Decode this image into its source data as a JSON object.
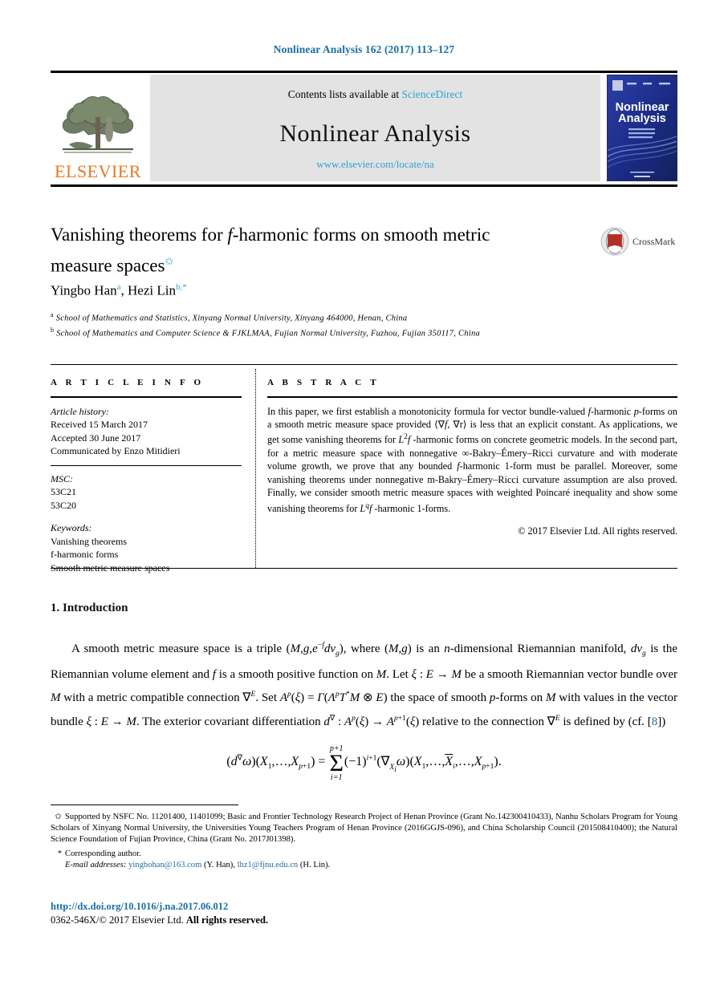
{
  "running_head": "Nonlinear Analysis 162 (2017) 113–127",
  "masthead": {
    "publisher_name": "ELSEVIER",
    "contents_prefix": "Contents lists available at ",
    "contents_link": "ScienceDirect",
    "journal_name": "Nonlinear Analysis",
    "journal_url": "www.elsevier.com/locate/na",
    "cover_title_line1": "Nonlinear",
    "cover_title_line2": "Analysis"
  },
  "article": {
    "title_part1": "Vanishing theorems for ",
    "title_math": "f",
    "title_part2": "-harmonic forms on smooth metric",
    "title_line2": "measure spaces",
    "title_footnote_mark": "✩",
    "crossmark_label": "CrossMark",
    "authors": [
      {
        "name": "Yingbo Han",
        "sup": "a"
      },
      {
        "name": "Hezi Lin",
        "sup": "b,*"
      }
    ],
    "authors_text": "Yingbo Han",
    "affiliations": [
      {
        "mark": "a",
        "text": "School of Mathematics and Statistics, Xinyang Normal University, Xinyang 464000, Henan, China"
      },
      {
        "mark": "b",
        "text": "School of Mathematics and Computer Science & FJKLMAA, Fujian Normal University, Fuzhou, Fujian 350117, China"
      }
    ]
  },
  "info": {
    "heading": "A R T I C L E    I N F O",
    "history_label": "Article history:",
    "history": [
      "Received 15 March 2017",
      "Accepted 30 June 2017",
      "Communicated by Enzo Mitidieri"
    ],
    "msc_label": "MSC:",
    "msc": [
      "53C21",
      "53C20"
    ],
    "keywords_label": "Keywords:",
    "keywords": [
      "Vanishing theorems",
      "f-harmonic forms",
      "Smooth metric measure spaces"
    ]
  },
  "abstract": {
    "heading": "A B S T R A C T",
    "paragraph_1": "In this paper, we first establish a monotonicity formula for vector bundle-valued",
    "paragraph_2": "-harmonic ",
    "paragraph_3": "-forms on a smooth metric measure space provided ⟨∇",
    "paragraph_4": ", ∇r⟩ is",
    "paragraph_5": "less that an explicit constant. As applications, we get some vanishing theorems for ",
    "paragraph_6": " -harmonic forms on concrete geometric models. In the second part, for a metric measure space with nonnegative ∞-Bakry–Émery–Ricci curvature and with moderate volume growth, we prove that any bounded ",
    "paragraph_7": "-harmonic 1-form must be parallel. Moreover, some vanishing theorems under nonnegative m-Bakry–Émery–Ricci curvature assumption are also proved. Finally, we consider smooth metric measure spaces with weighted Poincaré inequality and show some vanishing theorems for ",
    "paragraph_8": " -harmonic 1-forms.",
    "copyright": "© 2017 Elsevier Ltd. All rights reserved."
  },
  "body": {
    "section_number_title": "1. Introduction",
    "para_1_a": "A smooth metric measure space is a triple (",
    "para_1_b": "), where (",
    "para_1_c": ") is an ",
    "para_1_d": "-dimensional Riemannian manifold, ",
    "para_1_e": " is the Riemannian volume element and ",
    "para_1_f": " is a smooth positive function on ",
    "para_1_g": ". Let ",
    "para_1_h": " be a smooth Riemannian vector bundle over ",
    "para_1_i": " with a metric compatible connection ",
    "para_1_j": ". Set ",
    "para_1_k": " the space of smooth ",
    "para_1_l": "-forms on ",
    "para_1_m": " with values in the vector bundle ",
    "para_1_n": ". The exterior covariant differentiation ",
    "para_1_o": " relative to the connection ",
    "para_1_p": " is defined by (cf. [",
    "reference_number": "8",
    "para_1_q": "])",
    "equation_label": "(d∇ω)(X1,…,Xp+1) = Σ(−1)^(i+1)(∇Xi ω)(X1,…,X̂i,…,Xp+1)."
  },
  "footnotes": {
    "support_mark": "✩",
    "support_text": "Supported by NSFC No. 11201400, 11401099; Basic and Frontier Technology Research Project of Henan Province (Grant No.142300410433), Nanhu Scholars Program for Young Scholars of Xinyang Normal University, the Universities Young Teachers Program of Henan Province (2016GGJS-096), and China Scholarship Council (201508410400); the Natural Science Foundation of Fujian Province, China (Grant No. 2017J01398).",
    "corresponding_mark": "*",
    "corresponding_text": "Corresponding author.",
    "email_label": "E-mail addresses:",
    "emails": [
      {
        "address": "yingbohan@163.com",
        "owner": "(Y. Han)"
      },
      {
        "address": "lhz1@fjnu.edu.cn",
        "owner": "(H. Lin)"
      }
    ]
  },
  "footer": {
    "doi": "http://dx.doi.org/10.1016/j.na.2017.06.012",
    "issn_line_plain": "0362-546X/© 2017 Elsevier Ltd. ",
    "issn_line_bold": "All rights reserved."
  },
  "colors": {
    "link_blue": "#1a6ea5",
    "sciencedirect_blue": "#2e9fd4",
    "elsevier_orange": "#e87722",
    "banner_gray": "#e3e3e3",
    "cover_blue": "#1d2f8f"
  }
}
